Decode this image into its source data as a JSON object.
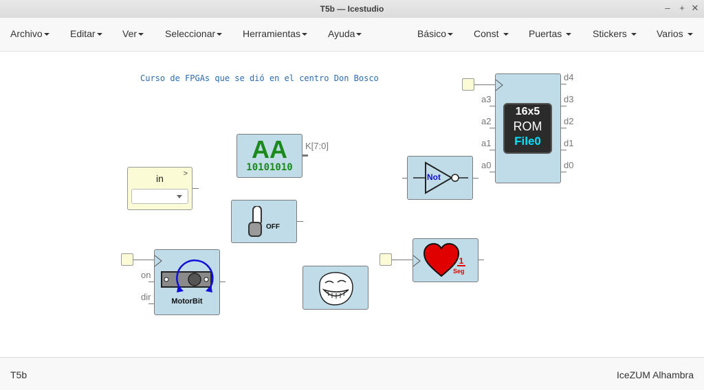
{
  "window": {
    "title": "T5b — Icestudio"
  },
  "menu_left": [
    {
      "label": "Archivo"
    },
    {
      "label": "Editar"
    },
    {
      "label": "Ver"
    },
    {
      "label": "Seleccionar"
    },
    {
      "label": "Herramientas"
    },
    {
      "label": "Ayuda"
    }
  ],
  "menu_right": [
    {
      "label": "Básico"
    },
    {
      "label": "Const"
    },
    {
      "label": "Puertas"
    },
    {
      "label": "Stickers"
    },
    {
      "label": "Varios"
    }
  ],
  "canvas": {
    "note": "Curso de FPGAs que se dió en el centro Don Bosco",
    "input_block": {
      "label": "in",
      "arrow": ">"
    },
    "const_block": {
      "big": "AA",
      "bits": "10101010",
      "port": "K[7:0]"
    },
    "switch_block": {
      "state": "OFF"
    },
    "motor_block": {
      "label": "MotorBit",
      "pins": [
        "on",
        "dir"
      ]
    },
    "not_block": {
      "label": "Not"
    },
    "heart_block": {
      "num": "1",
      "unit": "Seg"
    },
    "rom_block": {
      "line1": "16x5",
      "line2": "ROM",
      "line3": "File0",
      "in_pins": [
        "a3",
        "a2",
        "a1",
        "a0"
      ],
      "out_pins": [
        "d4",
        "d3",
        "d2",
        "d1",
        "d0"
      ]
    }
  },
  "status": {
    "left": "T5b",
    "right": "IceZUM Alhambra"
  },
  "colors": {
    "block_bg": "#bfdce8",
    "input_bg": "#fbfbd6",
    "note": "#2a6bb0",
    "const_green": "#1a8a1a",
    "heart": "#e00000",
    "rom_cyan": "#00e5ff"
  }
}
